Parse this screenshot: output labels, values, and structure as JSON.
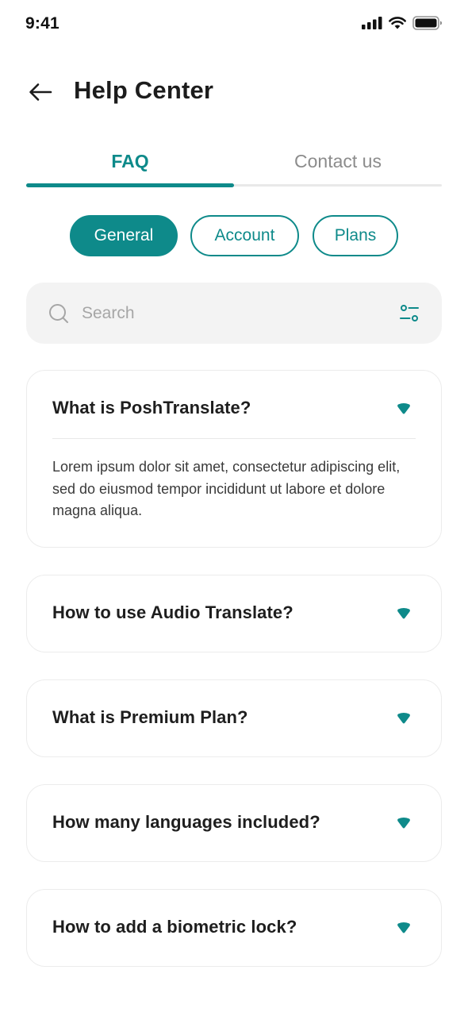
{
  "status_bar": {
    "time": "9:41",
    "icons": [
      "signal-icon",
      "wifi-icon",
      "battery-icon"
    ]
  },
  "header": {
    "back_icon": "arrow-left-icon",
    "title": "Help Center"
  },
  "tabs": [
    {
      "label": "FAQ",
      "active": true
    },
    {
      "label": "Contact us",
      "active": false
    }
  ],
  "chips": [
    {
      "label": "General",
      "selected": true
    },
    {
      "label": "Account",
      "selected": false
    },
    {
      "label": "Plans",
      "selected": false
    }
  ],
  "search": {
    "value": "",
    "placeholder": "Search",
    "icon": "search-icon",
    "filter_icon": "filter-icon"
  },
  "faqs": [
    {
      "question": "What is PoshTranslate?",
      "expanded": true,
      "answer": "Lorem ipsum dolor sit amet, consectetur adipiscing elit, sed do eiusmod tempor incididunt ut labore et dolore magna aliqua."
    },
    {
      "question": "How to use Audio Translate?",
      "expanded": false
    },
    {
      "question": "What is Premium Plan?",
      "expanded": false
    },
    {
      "question": "How many languages included?",
      "expanded": false
    },
    {
      "question": "How to add a biometric lock?",
      "expanded": false
    }
  ],
  "colors": {
    "accent": "#0e8a8a",
    "text_dark": "#1e1e1e",
    "text_muted": "#8c8c8c",
    "surface": "#f3f3f3",
    "border": "#ececec"
  }
}
